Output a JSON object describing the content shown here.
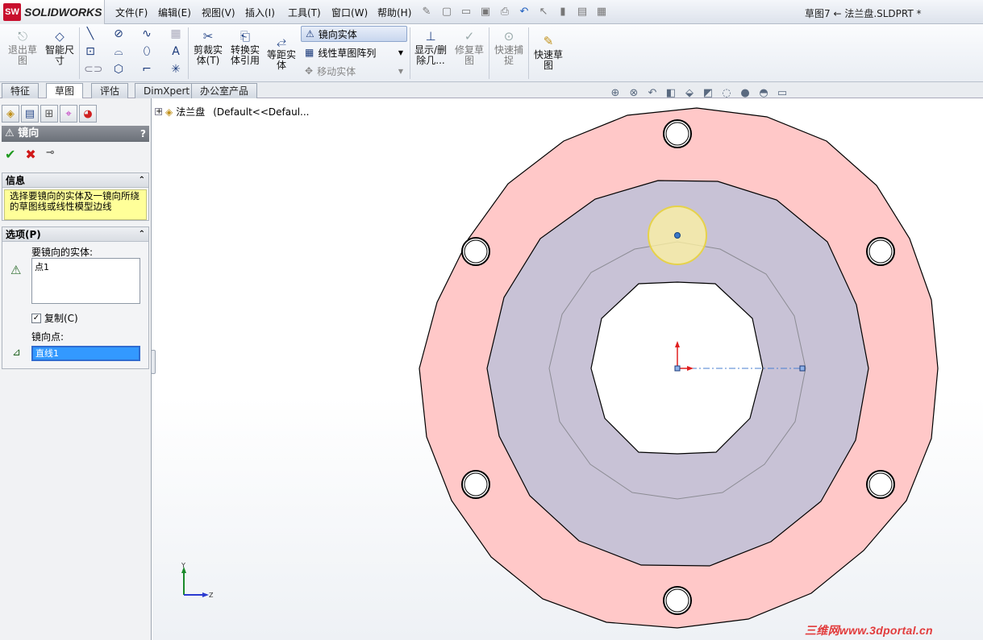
{
  "app": {
    "name": "SOLIDWORKS",
    "logo_mark": "SW"
  },
  "menu": [
    "文件(F)",
    "编辑(E)",
    "视图(V)",
    "插入(I)",
    "工具(T)",
    "窗口(W)",
    "帮助(H)"
  ],
  "document_title": "草图7 ← 法兰盘.SLDPRT *",
  "ribbon": {
    "exit_sketch": "退出草图",
    "smart_dim": "智能尺寸",
    "trim": "剪裁实体(T)",
    "convert": "转换实体引用",
    "offset": "等距实体",
    "mirror": "镜向实体",
    "linear_pattern": "线性草图阵列",
    "move": "移动实体",
    "display_delete": "显示/删除几...",
    "repair": "修复草图",
    "quick_snap": "快速捕捉",
    "rapid_sketch": "快速草图"
  },
  "tabs": [
    "特征",
    "草图",
    "评估",
    "DimXpert",
    "办公室产品"
  ],
  "active_tab": "草图",
  "tree": {
    "part_name": "法兰盘",
    "config": "(Default<<Defaul..."
  },
  "property_manager": {
    "title": "镜向",
    "help": "?",
    "info_header": "信息",
    "info_text": "选择要镜向的实体及一镜向所绕的草图线或线性模型边线",
    "options_header": "选项(P)",
    "entities_label": "要镜向的实体:",
    "entities_value": "点1",
    "copy_label": "复制(C)",
    "copy_checked": true,
    "mirror_about_label": "镜向点:",
    "mirror_about_value": "直线1"
  },
  "triad": {
    "y": "Y",
    "z": "Z"
  },
  "watermark": "三维网www.3dportal.cn",
  "colors": {
    "flange_outer": "#ffc8c8",
    "flange_inner": "#c8c2d6",
    "highlight": "#fff3a0",
    "info_bg": "#ffff99",
    "accent": "#3399ff"
  }
}
